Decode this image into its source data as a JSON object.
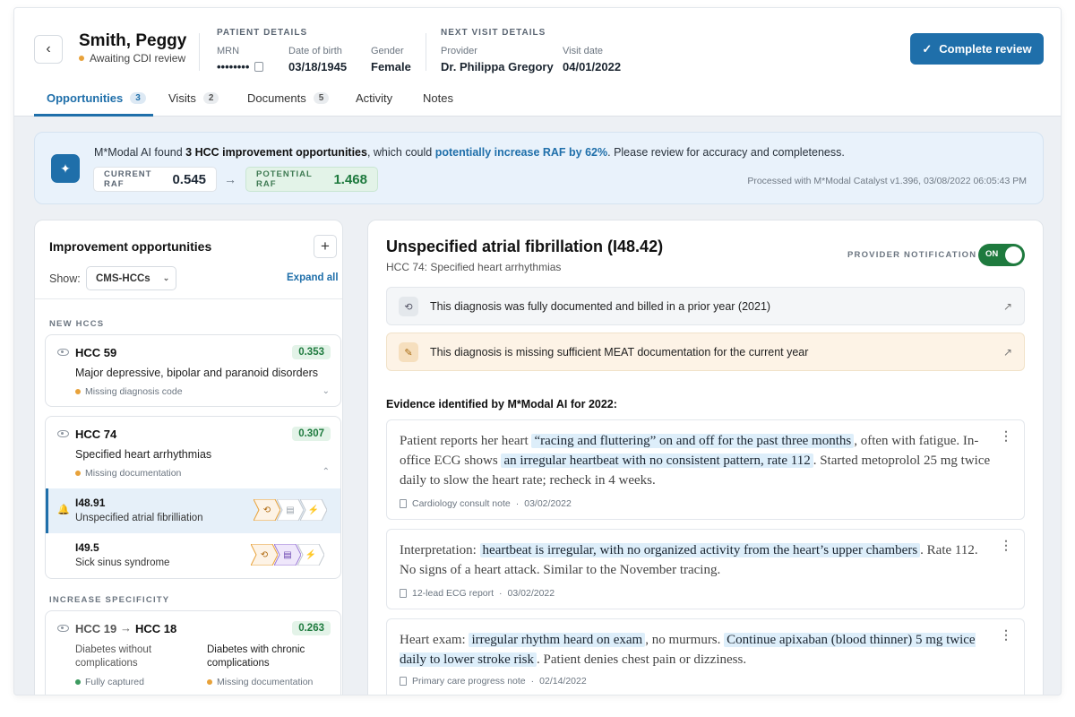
{
  "patient": {
    "name": "Smith, Peggy",
    "status": "Awaiting CDI review"
  },
  "patient_details": {
    "section_title": "PATIENT DETAILS",
    "mrn_label": "MRN",
    "mrn_value": "••••••••",
    "dob_label": "Date of birth",
    "dob_value": "03/18/1945",
    "gender_label": "Gender",
    "gender_value": "Female"
  },
  "visit_details": {
    "section_title": "NEXT VISIT DETAILS",
    "provider_label": "Provider",
    "provider_value": "Dr. Philippa Gregory",
    "date_label": "Visit date",
    "date_value": "04/01/2022"
  },
  "complete_button": "Complete review",
  "tabs": [
    {
      "label": "Opportunities",
      "count": "3"
    },
    {
      "label": "Visits",
      "count": "2"
    },
    {
      "label": "Documents",
      "count": "5"
    },
    {
      "label": "Activity"
    },
    {
      "label": "Notes"
    }
  ],
  "banner": {
    "text_pre": "M*Modal AI found ",
    "text_bold": "3 HCC improvement opportunities",
    "text_mid": ", which could ",
    "text_link": "potentially increase RAF by 62%",
    "text_post": ". Please review for accuracy and completeness.",
    "current_raf_label": "CURRENT RAF",
    "current_raf_value": "0.545",
    "potential_raf_label": "POTENTIAL RAF",
    "potential_raf_value": "1.468",
    "processed": "Processed with M*Modal Catalyst v1.396, 03/08/2022 06:05:43 PM"
  },
  "left_panel": {
    "title": "Improvement opportunities",
    "show_label": "Show:",
    "show_value": "CMS-HCCs",
    "expand_all": "Expand all",
    "group_new": "NEW HCCS",
    "group_specificity": "INCREASE SPECIFICITY",
    "cards": [
      {
        "hcc": "HCC 59",
        "score": "0.353",
        "desc": "Major depressive, bipolar and paranoid disorders",
        "status": "Missing diagnosis code"
      },
      {
        "hcc": "HCC 74",
        "score": "0.307",
        "desc": "Specified heart arrhythmias",
        "status": "Missing documentation",
        "codes": [
          {
            "code": "I48.91",
            "desc": "Unspecified atrial fibrilliation"
          },
          {
            "code": "I49.5",
            "desc": "Sick sinus syndrome"
          }
        ]
      }
    ],
    "spec_card": {
      "from": "HCC 19",
      "to": "HCC 18",
      "score": "0.263",
      "from_desc": "Diabetes without complications",
      "from_status": "Fully captured",
      "to_desc": "Diabetes with chronic complications",
      "to_status": "Missing documentation"
    }
  },
  "right_panel": {
    "title": "Unspecified atrial fibrillation (I48.42)",
    "subtitle": "HCC 74: Specified heart arrhythmias",
    "provider_notification_label": "PROVIDER NOTIFICATION",
    "toggle_label": "ON",
    "notice_1": "This diagnosis was fully documented and billed in a prior year (2021)",
    "notice_2": "This diagnosis is missing sufficient MEAT documentation for the current year",
    "evidence_title": "Evidence identified by M*Modal AI for 2022:",
    "evidence": [
      {
        "t1": "Patient reports her heart ",
        "h1": "“racing and fluttering” on and off for the past three months",
        "t2": ", often with fatigue. In-office ECG shows ",
        "h2": "an irregular heartbeat with no consistent pattern, rate 112",
        "t3": ". Started metoprolol 25 mg twice daily to slow the heart rate; recheck in 4 weeks.",
        "source": "Cardiology consult note",
        "date": "03/02/2022"
      },
      {
        "t1": "Interpretation: ",
        "h1": "heartbeat is irregular, with no organized activity from the heart’s upper chambers",
        "t2": ". Rate 112. No signs of a heart attack. Similar to the November tracing.",
        "source": "12-lead ECG report",
        "date": "03/02/2022"
      },
      {
        "t1": "Heart exam: ",
        "h1": "irregular rhythm heard on exam",
        "t2": ", no murmurs. ",
        "h2": "Continue apixaban (blood thinner) 5 mg twice daily to lower stroke risk",
        "t3": ". Patient denies chest pain or dizziness.",
        "source": "Primary care progress note",
        "date": "02/14/2022"
      }
    ]
  },
  "colors": {
    "accent": "#1f6faa",
    "success": "#1e7a3e",
    "warning": "#e8a23a"
  }
}
